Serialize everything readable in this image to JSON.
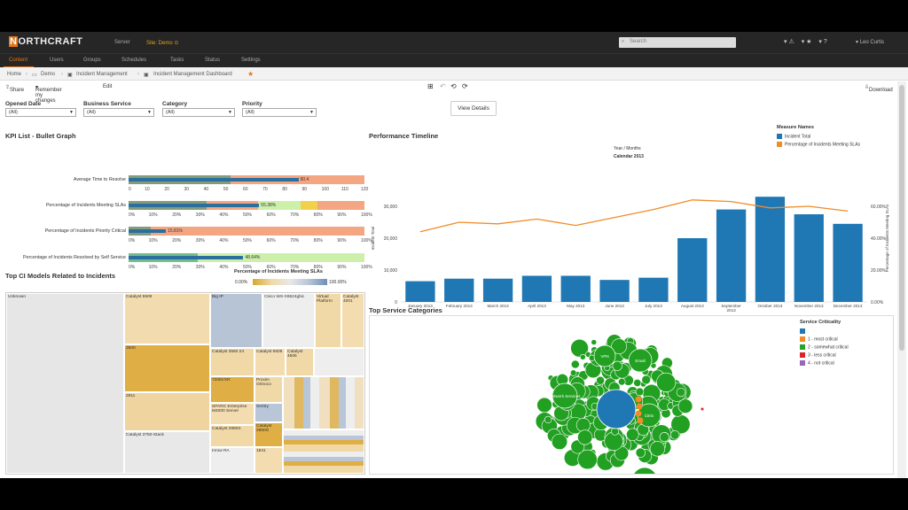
{
  "header": {
    "logo": "ORTHCRAFT",
    "logo_initial": "N",
    "server_label": "Server",
    "site_label": "Site: Demo",
    "search_placeholder": "Search",
    "user": "Leo Curtis"
  },
  "nav": {
    "items": [
      "Content",
      "Users",
      "Groups",
      "Schedules",
      "Tasks",
      "Status",
      "Settings"
    ],
    "active": "Content"
  },
  "breadcrumb": [
    "Home",
    "Demo",
    "Incident Management",
    "Incident Management Dashboard"
  ],
  "toolbar": {
    "share": "Share",
    "remember": "Remember my changes",
    "edit": "Edit",
    "download": "Download",
    "view_details": "View Details"
  },
  "filters": [
    {
      "label": "Opened Date",
      "value": "(All)"
    },
    {
      "label": "Business Service",
      "value": "(All)"
    },
    {
      "label": "Category",
      "value": "(All)"
    },
    {
      "label": "Priority",
      "value": "(All)"
    }
  ],
  "kpi": {
    "title": "KPI List - Bullet Graph",
    "rows": [
      {
        "label": "Average Time to Resolve",
        "value": 90,
        "value_label": "90.4",
        "max": 125,
        "color": "#f4a582",
        "band": "#e8e8e8",
        "ticks": [
          "0",
          "10",
          "20",
          "30",
          "40",
          "50",
          "60",
          "70",
          "80",
          "90",
          "100",
          "110",
          "120"
        ]
      },
      {
        "label": "Percentage of Incidents Meeting SLAs",
        "value": 0.5538,
        "value_label": "55.38%",
        "max": 1,
        "color": "#f4a582",
        "ticks": [
          "0%",
          "10%",
          "20%",
          "30%",
          "40%",
          "50%",
          "60%",
          "70%",
          "80%",
          "90%",
          "100%"
        ]
      },
      {
        "label": "Percentage of Incidents Priority Critical",
        "value": 0.1581,
        "value_label": "15.81%",
        "max": 1,
        "color": "#f4a582",
        "ticks": [
          "0%",
          "10%",
          "20%",
          "30%",
          "40%",
          "50%",
          "60%",
          "70%",
          "80%",
          "90%",
          "100%"
        ]
      },
      {
        "label": "Percentage of Incidents Resolved by Self Service",
        "value": 0.4864,
        "value_label": "48.64%",
        "max": 1,
        "color": "#ccf0aa",
        "ticks": [
          "0%",
          "10%",
          "20%",
          "30%",
          "40%",
          "50%",
          "60%",
          "70%",
          "80%",
          "90%",
          "100%"
        ]
      }
    ]
  },
  "treemap": {
    "title": "Top CI Models Related to Incidents",
    "legend_title": "Percentage of Incidents Meeting SLAs",
    "legend_min": "0.00%",
    "legend_max": "100.00%",
    "cells": [
      "Unknown",
      "Catalyst 5509",
      "Big IP",
      "Cisco WS-X6524gbic",
      "Catalyst 4001",
      "Catalyst 4048",
      "Catalyst 3550 24",
      "Catalyst 6509",
      "Catalyst 4506",
      "3500",
      "7206VXR",
      "Proxim Orinoco",
      "SPARC Enterprise M4000 Server",
      "2811",
      "Sentry",
      "Catalyst 2960S",
      "Catalyst 2960G",
      "Catalyst 3750-Stack",
      "Inrow RA",
      "1841",
      "Virtual Platform"
    ]
  },
  "timeline": {
    "title": "Performance Timeline",
    "subtitle_year": "Year  /  Months",
    "subtitle_year2": "Calendar 2013",
    "legend_title": "Measure Names",
    "legend": [
      "Incident Total",
      "Percentage of Incidents Meeting SLAs"
    ],
    "y_label": "Incident Total",
    "y2_label": "Percentage of Incidents Meeting SLAs"
  },
  "chart_data": {
    "type": "bar",
    "categories": [
      "January 2013",
      "February 2013",
      "March 2013",
      "April 2013",
      "May 2013",
      "June 2013",
      "July 2013",
      "August 2013",
      "September 2013",
      "October 2013",
      "November 2013",
      "December 2013"
    ],
    "series": [
      {
        "name": "Incident Total",
        "values": [
          6500,
          7300,
          7300,
          8200,
          8200,
          6900,
          7600,
          20000,
          29000,
          33000,
          27500,
          24500
        ]
      },
      {
        "name": "Percentage of Incidents Meeting SLAs",
        "values": [
          44,
          50,
          49,
          52,
          48,
          53,
          58,
          64,
          63,
          59,
          60,
          57
        ]
      }
    ],
    "y_ticks": [
      "0",
      "10,000",
      "20,000",
      "30,000"
    ],
    "y_max": 40000,
    "y2_ticks": [
      "0.00%",
      "20.00%",
      "40.00%",
      "60.00%"
    ],
    "y2_max": 80,
    "colors": [
      "#1f77b4",
      "#f08c28"
    ]
  },
  "bubbles": {
    "title": "Top Service Categories",
    "legend_title": "Service Criticality",
    "legend": [
      {
        "label": "",
        "color": "#1f77b4"
      },
      {
        "label": "1 - most critical",
        "color": "#f08c28"
      },
      {
        "label": "2 - somewhat critical",
        "color": "#2ca02c"
      },
      {
        "label": "3 - less critical",
        "color": "#d62728"
      },
      {
        "label": "4 - not critical",
        "color": "#9467bd"
      }
    ],
    "labels": [
      "Network Services",
      "Email",
      "SAP CRM",
      "Citrix",
      "VPN"
    ]
  }
}
